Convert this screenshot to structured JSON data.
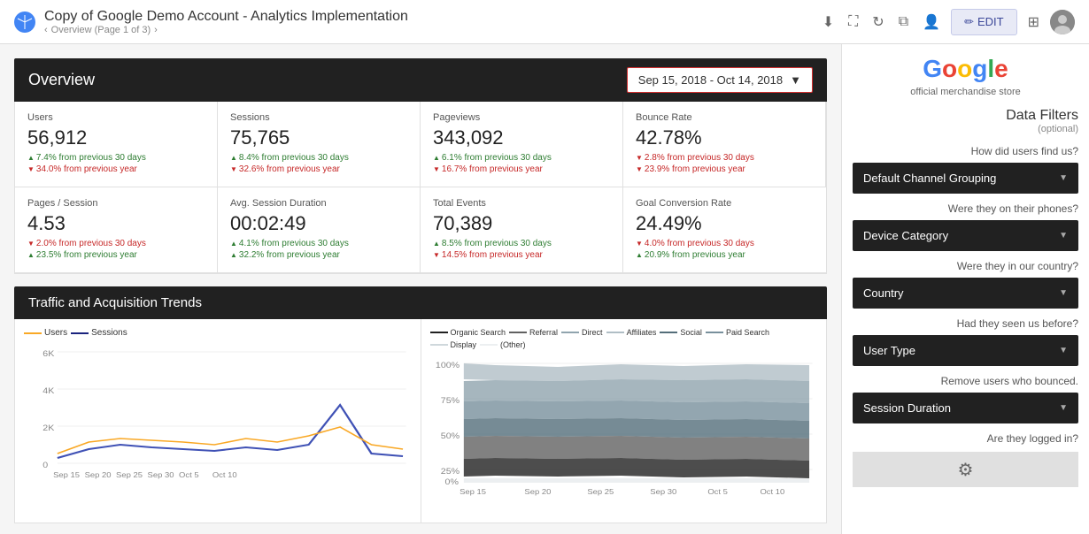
{
  "header": {
    "title": "Copy of Google Demo Account - Analytics Implementation",
    "subtitle": "Overview (Page 1 of 3)",
    "edit_label": "EDIT"
  },
  "overview": {
    "title": "Overview",
    "date_range": "Sep 15, 2018 - Oct 14, 2018",
    "metrics": [
      {
        "label": "Users",
        "value": "56,912",
        "changes": [
          {
            "dir": "up",
            "text": "7.4% from previous 30 days"
          },
          {
            "dir": "down",
            "text": "34.0% from previous year"
          }
        ]
      },
      {
        "label": "Sessions",
        "value": "75,765",
        "changes": [
          {
            "dir": "up",
            "text": "8.4% from previous 30 days"
          },
          {
            "dir": "down",
            "text": "32.6% from previous year"
          }
        ]
      },
      {
        "label": "Pageviews",
        "value": "343,092",
        "changes": [
          {
            "dir": "up",
            "text": "6.1% from previous 30 days"
          },
          {
            "dir": "down",
            "text": "16.7% from previous year"
          }
        ]
      },
      {
        "label": "Bounce Rate",
        "value": "42.78%",
        "changes": [
          {
            "dir": "down",
            "text": "2.8% from previous 30 days"
          },
          {
            "dir": "down",
            "text": "23.9% from previous year"
          }
        ]
      },
      {
        "label": "Pages / Session",
        "value": "4.53",
        "changes": [
          {
            "dir": "down",
            "text": "2.0% from previous 30 days"
          },
          {
            "dir": "up",
            "text": "23.5% from previous year"
          }
        ]
      },
      {
        "label": "Avg. Session Duration",
        "value": "00:02:49",
        "changes": [
          {
            "dir": "up",
            "text": "4.1% from previous 30 days"
          },
          {
            "dir": "up",
            "text": "32.2% from previous year"
          }
        ]
      },
      {
        "label": "Total Events",
        "value": "70,389",
        "changes": [
          {
            "dir": "up",
            "text": "8.5% from previous 30 days"
          },
          {
            "dir": "down",
            "text": "14.5% from previous year"
          }
        ]
      },
      {
        "label": "Goal Conversion Rate",
        "value": "24.49%",
        "changes": [
          {
            "dir": "down",
            "text": "4.0% from previous 30 days"
          },
          {
            "dir": "up",
            "text": "20.9% from previous year"
          }
        ]
      }
    ]
  },
  "traffic": {
    "title": "Traffic and Acquisition Trends",
    "chart1": {
      "legend": [
        {
          "label": "Users",
          "color": "#f9a825"
        },
        {
          "label": "Sessions",
          "color": "#1a237e"
        }
      ],
      "x_labels": [
        "Sep 15",
        "Sep 20",
        "Sep 25",
        "Sep 30",
        "Oct 5",
        "Oct 10"
      ]
    },
    "chart2": {
      "legend": [
        {
          "label": "Organic Search",
          "color": "#212121"
        },
        {
          "label": "Referral",
          "color": "#616161"
        },
        {
          "label": "Direct",
          "color": "#90a4ae"
        },
        {
          "label": "Affiliates",
          "color": "#b0bec5"
        },
        {
          "label": "Social",
          "color": "#546e7a"
        },
        {
          "label": "Paid Search",
          "color": "#78909c"
        },
        {
          "label": "Display",
          "color": "#b0bec5"
        },
        {
          "label": "(Other)",
          "color": "#cfd8dc"
        }
      ],
      "x_labels": [
        "Sep 15",
        "Sep 20",
        "Sep 25",
        "Sep 30",
        "Oct 5",
        "Oct 10"
      ],
      "y_labels": [
        "100%",
        "75%",
        "50%",
        "25%",
        "0%"
      ]
    }
  },
  "sidebar": {
    "google_store": "official merchandise store",
    "filters_title": "Data Filters",
    "filters_subtitle": "(optional)",
    "filters": [
      {
        "question": "How did users find us?",
        "label": "Default Channel Grouping"
      },
      {
        "question": "Were they on their phones?",
        "label": "Device Category"
      },
      {
        "question": "Were they in our country?",
        "label": "Country"
      },
      {
        "question": "Had they seen us before?",
        "label": "User Type"
      },
      {
        "question": "Remove users who bounced.",
        "label": "Session Duration"
      },
      {
        "question": "Are they logged in?",
        "label": ""
      }
    ]
  }
}
